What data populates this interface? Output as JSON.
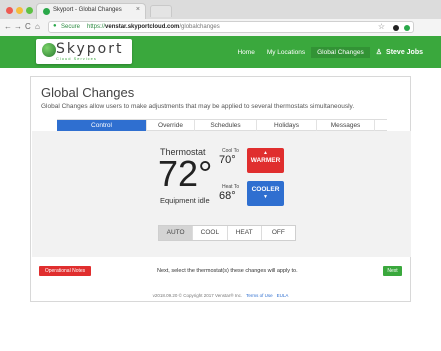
{
  "browser": {
    "tab_title": "Skyport - Global Changes",
    "tab_close": "×",
    "nav_back": "←",
    "nav_forward": "→",
    "nav_reload": "C",
    "nav_home": "⌂",
    "secure_label": "Secure",
    "url_prefix": "https://",
    "url_host": "venstar.skyportcloud.com",
    "url_path": "/globalchanges",
    "star": "☆"
  },
  "header": {
    "logo_text": "Skyport",
    "logo_sub": "Cloud Services",
    "nav": [
      {
        "label": "Home"
      },
      {
        "label": "My Locations"
      },
      {
        "label": "Global Changes"
      }
    ],
    "user_name": "Steve Jobs",
    "brand_color": "#3aa83d"
  },
  "page": {
    "title": "Global Changes",
    "description": "Global Changes allow users to make adjustments that may be applied to several thermostats simultaneously."
  },
  "tabs": [
    {
      "label": "Control",
      "active": true
    },
    {
      "label": "Override"
    },
    {
      "label": "Schedules"
    },
    {
      "label": "Holidays"
    },
    {
      "label": "Messages"
    }
  ],
  "thermostat": {
    "label": "Thermostat",
    "temperature": "72°",
    "status": "Equipment idle",
    "cool_to_label": "Cool To",
    "cool_to_value": "70°",
    "heat_to_label": "Heat To",
    "heat_to_value": "68°",
    "warmer_label": "WARMER",
    "cooler_label": "COOLER",
    "up_arrow": "▲",
    "down_arrow": "▼"
  },
  "modes": [
    {
      "label": "AUTO",
      "active": true
    },
    {
      "label": "COOL"
    },
    {
      "label": "HEAT"
    },
    {
      "label": "OFF"
    }
  ],
  "actions": {
    "operational_notes": "Operational Notes",
    "next_message": "Next, select the thermostat(s) these changes will apply to.",
    "next": "Next"
  },
  "footer": {
    "copyright": "v2018.09.20 © Copyright 2017 Venstar® Inc.",
    "terms": "Terms of Use",
    "eula": "EULA"
  }
}
